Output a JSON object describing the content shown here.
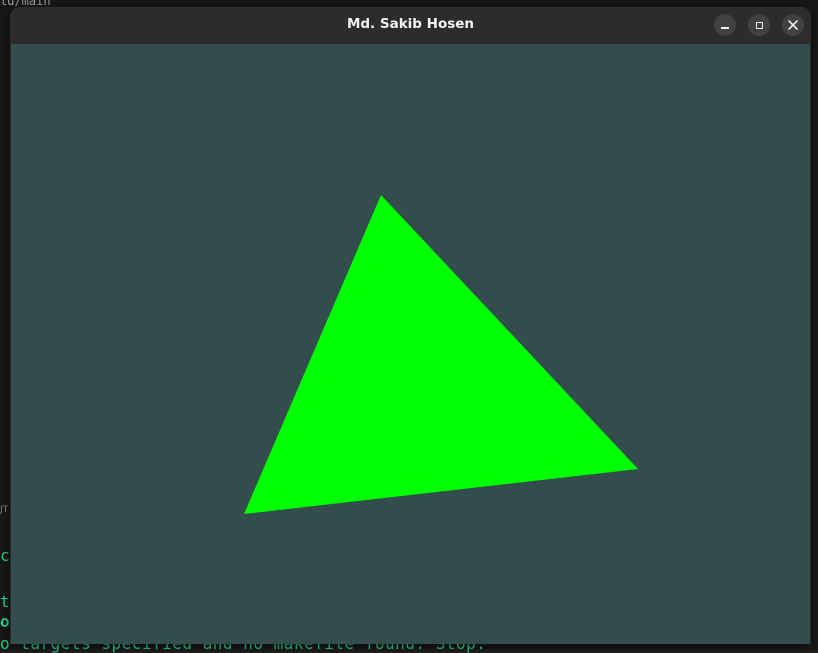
{
  "window": {
    "title": "Md. Sakib Hosen"
  },
  "canvas": {
    "clear_color": "#334d4d",
    "shape": "triangle",
    "fill_color": "#00ff00"
  },
  "background_terminal": {
    "path_text": "ld/main",
    "panel_label": "JT",
    "lines": [
      "ci",
      " t",
      "o",
      "o targets specified and no makefile found.  Stop."
    ],
    "text_color": "#23d18b"
  }
}
